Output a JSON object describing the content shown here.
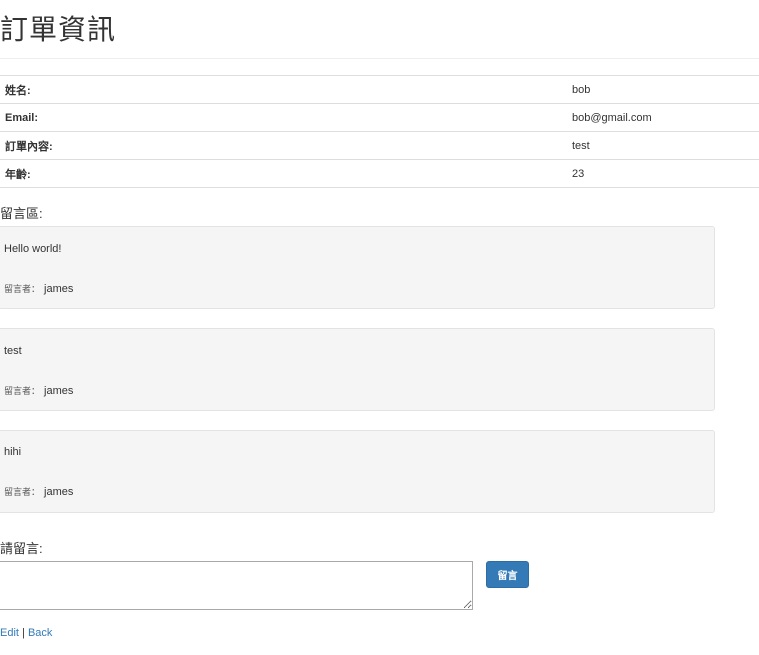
{
  "page": {
    "title": "訂單資訊"
  },
  "order_info": [
    {
      "label": "姓名:",
      "value": "bob"
    },
    {
      "label": "Email:",
      "value": "bob@gmail.com"
    },
    {
      "label": "訂單內容:",
      "value": "test"
    },
    {
      "label": "年齡:",
      "value": "23"
    }
  ],
  "comments": {
    "heading": "留言區:",
    "author_label": "留言者：",
    "items": [
      {
        "text": "Hello world!",
        "author": "james"
      },
      {
        "text": "test",
        "author": "james"
      },
      {
        "text": "hihi",
        "author": "james"
      }
    ]
  },
  "comment_form": {
    "heading": "請留言:",
    "input_value": "",
    "submit_label": "留言"
  },
  "links": {
    "edit": "Edit",
    "separator": "|",
    "back": "Back"
  },
  "colors": {
    "link": "#337ab7",
    "button": "#337ab7",
    "well_background": "#f5f5f5",
    "border": "#dddddd"
  }
}
